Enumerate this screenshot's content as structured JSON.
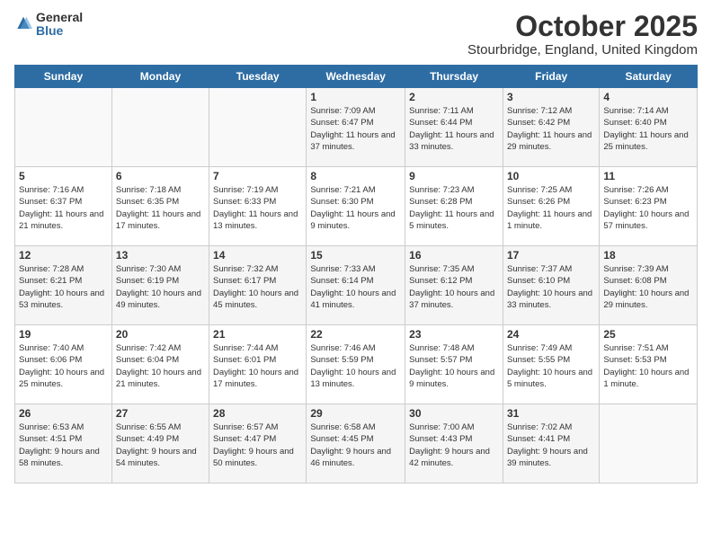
{
  "logo": {
    "general": "General",
    "blue": "Blue"
  },
  "title": "October 2025",
  "subtitle": "Stourbridge, England, United Kingdom",
  "days_of_week": [
    "Sunday",
    "Monday",
    "Tuesday",
    "Wednesday",
    "Thursday",
    "Friday",
    "Saturday"
  ],
  "weeks": [
    [
      {
        "day": "",
        "info": ""
      },
      {
        "day": "",
        "info": ""
      },
      {
        "day": "",
        "info": ""
      },
      {
        "day": "1",
        "info": "Sunrise: 7:09 AM\nSunset: 6:47 PM\nDaylight: 11 hours and 37 minutes."
      },
      {
        "day": "2",
        "info": "Sunrise: 7:11 AM\nSunset: 6:44 PM\nDaylight: 11 hours and 33 minutes."
      },
      {
        "day": "3",
        "info": "Sunrise: 7:12 AM\nSunset: 6:42 PM\nDaylight: 11 hours and 29 minutes."
      },
      {
        "day": "4",
        "info": "Sunrise: 7:14 AM\nSunset: 6:40 PM\nDaylight: 11 hours and 25 minutes."
      }
    ],
    [
      {
        "day": "5",
        "info": "Sunrise: 7:16 AM\nSunset: 6:37 PM\nDaylight: 11 hours and 21 minutes."
      },
      {
        "day": "6",
        "info": "Sunrise: 7:18 AM\nSunset: 6:35 PM\nDaylight: 11 hours and 17 minutes."
      },
      {
        "day": "7",
        "info": "Sunrise: 7:19 AM\nSunset: 6:33 PM\nDaylight: 11 hours and 13 minutes."
      },
      {
        "day": "8",
        "info": "Sunrise: 7:21 AM\nSunset: 6:30 PM\nDaylight: 11 hours and 9 minutes."
      },
      {
        "day": "9",
        "info": "Sunrise: 7:23 AM\nSunset: 6:28 PM\nDaylight: 11 hours and 5 minutes."
      },
      {
        "day": "10",
        "info": "Sunrise: 7:25 AM\nSunset: 6:26 PM\nDaylight: 11 hours and 1 minute."
      },
      {
        "day": "11",
        "info": "Sunrise: 7:26 AM\nSunset: 6:23 PM\nDaylight: 10 hours and 57 minutes."
      }
    ],
    [
      {
        "day": "12",
        "info": "Sunrise: 7:28 AM\nSunset: 6:21 PM\nDaylight: 10 hours and 53 minutes."
      },
      {
        "day": "13",
        "info": "Sunrise: 7:30 AM\nSunset: 6:19 PM\nDaylight: 10 hours and 49 minutes."
      },
      {
        "day": "14",
        "info": "Sunrise: 7:32 AM\nSunset: 6:17 PM\nDaylight: 10 hours and 45 minutes."
      },
      {
        "day": "15",
        "info": "Sunrise: 7:33 AM\nSunset: 6:14 PM\nDaylight: 10 hours and 41 minutes."
      },
      {
        "day": "16",
        "info": "Sunrise: 7:35 AM\nSunset: 6:12 PM\nDaylight: 10 hours and 37 minutes."
      },
      {
        "day": "17",
        "info": "Sunrise: 7:37 AM\nSunset: 6:10 PM\nDaylight: 10 hours and 33 minutes."
      },
      {
        "day": "18",
        "info": "Sunrise: 7:39 AM\nSunset: 6:08 PM\nDaylight: 10 hours and 29 minutes."
      }
    ],
    [
      {
        "day": "19",
        "info": "Sunrise: 7:40 AM\nSunset: 6:06 PM\nDaylight: 10 hours and 25 minutes."
      },
      {
        "day": "20",
        "info": "Sunrise: 7:42 AM\nSunset: 6:04 PM\nDaylight: 10 hours and 21 minutes."
      },
      {
        "day": "21",
        "info": "Sunrise: 7:44 AM\nSunset: 6:01 PM\nDaylight: 10 hours and 17 minutes."
      },
      {
        "day": "22",
        "info": "Sunrise: 7:46 AM\nSunset: 5:59 PM\nDaylight: 10 hours and 13 minutes."
      },
      {
        "day": "23",
        "info": "Sunrise: 7:48 AM\nSunset: 5:57 PM\nDaylight: 10 hours and 9 minutes."
      },
      {
        "day": "24",
        "info": "Sunrise: 7:49 AM\nSunset: 5:55 PM\nDaylight: 10 hours and 5 minutes."
      },
      {
        "day": "25",
        "info": "Sunrise: 7:51 AM\nSunset: 5:53 PM\nDaylight: 10 hours and 1 minute."
      }
    ],
    [
      {
        "day": "26",
        "info": "Sunrise: 6:53 AM\nSunset: 4:51 PM\nDaylight: 9 hours and 58 minutes."
      },
      {
        "day": "27",
        "info": "Sunrise: 6:55 AM\nSunset: 4:49 PM\nDaylight: 9 hours and 54 minutes."
      },
      {
        "day": "28",
        "info": "Sunrise: 6:57 AM\nSunset: 4:47 PM\nDaylight: 9 hours and 50 minutes."
      },
      {
        "day": "29",
        "info": "Sunrise: 6:58 AM\nSunset: 4:45 PM\nDaylight: 9 hours and 46 minutes."
      },
      {
        "day": "30",
        "info": "Sunrise: 7:00 AM\nSunset: 4:43 PM\nDaylight: 9 hours and 42 minutes."
      },
      {
        "day": "31",
        "info": "Sunrise: 7:02 AM\nSunset: 4:41 PM\nDaylight: 9 hours and 39 minutes."
      },
      {
        "day": "",
        "info": ""
      }
    ]
  ]
}
